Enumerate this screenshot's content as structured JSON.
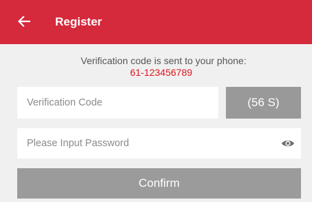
{
  "header": {
    "title": "Register",
    "back_icon": "arrow-left-icon",
    "background": "#d42a3c"
  },
  "verification": {
    "message": "Verification code is sent to your phone:",
    "phone": "61-123456789",
    "phone_color": "#e0151e"
  },
  "code_input": {
    "value": "",
    "placeholder": "Verification Code"
  },
  "countdown_button": {
    "label": "(56 S)"
  },
  "password_input": {
    "value": "",
    "placeholder": "Please Input Password",
    "toggle_icon": "eye-icon"
  },
  "confirm_button": {
    "label": "Confirm"
  }
}
